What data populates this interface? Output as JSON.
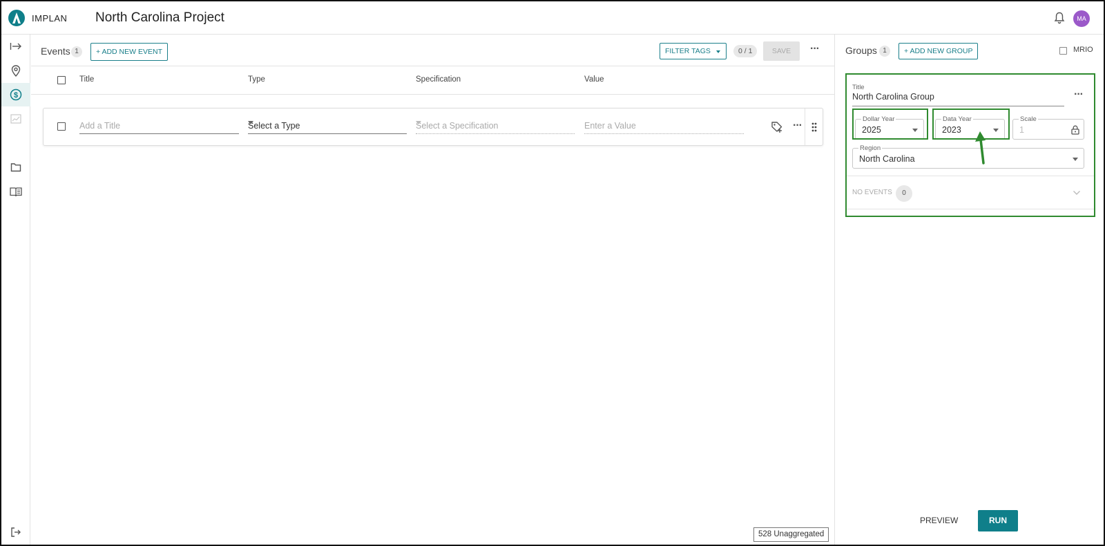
{
  "app": {
    "brand": "IMPLAN",
    "project_title": "North Carolina Project",
    "user_initials": "MA",
    "accent": "#1a7f8a",
    "highlight_color": "#2f8a2f"
  },
  "rail": {
    "items": [
      {
        "icon": "expand-arrow-icon"
      },
      {
        "icon": "location-pin-icon"
      },
      {
        "icon": "dollar-circle-icon",
        "active": true
      },
      {
        "icon": "chart-line-icon"
      },
      {
        "icon": "folder-icon"
      },
      {
        "icon": "book-icon"
      }
    ],
    "logout_icon": "logout-icon"
  },
  "events": {
    "label": "Events",
    "count": "1",
    "add_label": "+ ADD NEW EVENT",
    "filter_label": "FILTER TAGS",
    "selection_count": "0 / 1",
    "save_label": "SAVE",
    "columns": [
      "Title",
      "Type",
      "Specification",
      "Value"
    ],
    "row": {
      "title_placeholder": "Add a Title",
      "type_value": "Select a Type",
      "spec_placeholder": "Select a Specification",
      "value_placeholder": "Enter a Value"
    },
    "unaggregated": "528 Unaggregated"
  },
  "groups": {
    "label": "Groups",
    "count": "1",
    "add_label": "+ ADD NEW GROUP",
    "mrio_label": "MRIO",
    "card": {
      "title_label": "Title",
      "title_value": "North Carolina Group",
      "dollar_year_label": "Dollar Year",
      "dollar_year_value": "2025",
      "data_year_label": "Data Year",
      "data_year_value": "2023",
      "scale_label": "Scale",
      "scale_value": "1",
      "region_label": "Region",
      "region_value": "North Carolina",
      "no_events_label": "NO EVENTS",
      "no_events_count": "0"
    },
    "preview_label": "PREVIEW",
    "run_label": "RUN"
  }
}
